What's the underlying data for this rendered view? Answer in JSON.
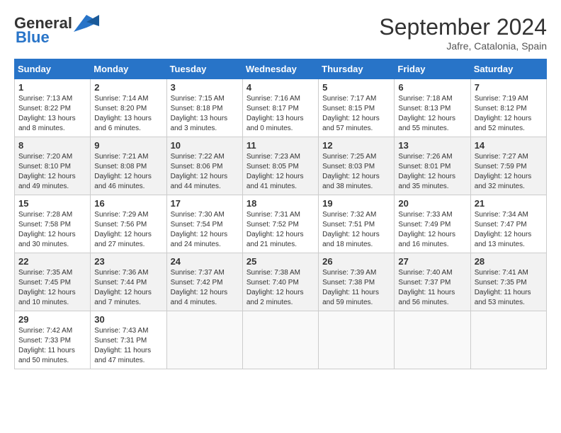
{
  "header": {
    "logo_line1": "General",
    "logo_line2": "Blue",
    "month_title": "September 2024",
    "subtitle": "Jafre, Catalonia, Spain"
  },
  "days_of_week": [
    "Sunday",
    "Monday",
    "Tuesday",
    "Wednesday",
    "Thursday",
    "Friday",
    "Saturday"
  ],
  "weeks": [
    [
      {
        "day": "1",
        "sunrise": "Sunrise: 7:13 AM",
        "sunset": "Sunset: 8:22 PM",
        "daylight": "Daylight: 13 hours and 8 minutes."
      },
      {
        "day": "2",
        "sunrise": "Sunrise: 7:14 AM",
        "sunset": "Sunset: 8:20 PM",
        "daylight": "Daylight: 13 hours and 6 minutes."
      },
      {
        "day": "3",
        "sunrise": "Sunrise: 7:15 AM",
        "sunset": "Sunset: 8:18 PM",
        "daylight": "Daylight: 13 hours and 3 minutes."
      },
      {
        "day": "4",
        "sunrise": "Sunrise: 7:16 AM",
        "sunset": "Sunset: 8:17 PM",
        "daylight": "Daylight: 13 hours and 0 minutes."
      },
      {
        "day": "5",
        "sunrise": "Sunrise: 7:17 AM",
        "sunset": "Sunset: 8:15 PM",
        "daylight": "Daylight: 12 hours and 57 minutes."
      },
      {
        "day": "6",
        "sunrise": "Sunrise: 7:18 AM",
        "sunset": "Sunset: 8:13 PM",
        "daylight": "Daylight: 12 hours and 55 minutes."
      },
      {
        "day": "7",
        "sunrise": "Sunrise: 7:19 AM",
        "sunset": "Sunset: 8:12 PM",
        "daylight": "Daylight: 12 hours and 52 minutes."
      }
    ],
    [
      {
        "day": "8",
        "sunrise": "Sunrise: 7:20 AM",
        "sunset": "Sunset: 8:10 PM",
        "daylight": "Daylight: 12 hours and 49 minutes."
      },
      {
        "day": "9",
        "sunrise": "Sunrise: 7:21 AM",
        "sunset": "Sunset: 8:08 PM",
        "daylight": "Daylight: 12 hours and 46 minutes."
      },
      {
        "day": "10",
        "sunrise": "Sunrise: 7:22 AM",
        "sunset": "Sunset: 8:06 PM",
        "daylight": "Daylight: 12 hours and 44 minutes."
      },
      {
        "day": "11",
        "sunrise": "Sunrise: 7:23 AM",
        "sunset": "Sunset: 8:05 PM",
        "daylight": "Daylight: 12 hours and 41 minutes."
      },
      {
        "day": "12",
        "sunrise": "Sunrise: 7:25 AM",
        "sunset": "Sunset: 8:03 PM",
        "daylight": "Daylight: 12 hours and 38 minutes."
      },
      {
        "day": "13",
        "sunrise": "Sunrise: 7:26 AM",
        "sunset": "Sunset: 8:01 PM",
        "daylight": "Daylight: 12 hours and 35 minutes."
      },
      {
        "day": "14",
        "sunrise": "Sunrise: 7:27 AM",
        "sunset": "Sunset: 7:59 PM",
        "daylight": "Daylight: 12 hours and 32 minutes."
      }
    ],
    [
      {
        "day": "15",
        "sunrise": "Sunrise: 7:28 AM",
        "sunset": "Sunset: 7:58 PM",
        "daylight": "Daylight: 12 hours and 30 minutes."
      },
      {
        "day": "16",
        "sunrise": "Sunrise: 7:29 AM",
        "sunset": "Sunset: 7:56 PM",
        "daylight": "Daylight: 12 hours and 27 minutes."
      },
      {
        "day": "17",
        "sunrise": "Sunrise: 7:30 AM",
        "sunset": "Sunset: 7:54 PM",
        "daylight": "Daylight: 12 hours and 24 minutes."
      },
      {
        "day": "18",
        "sunrise": "Sunrise: 7:31 AM",
        "sunset": "Sunset: 7:52 PM",
        "daylight": "Daylight: 12 hours and 21 minutes."
      },
      {
        "day": "19",
        "sunrise": "Sunrise: 7:32 AM",
        "sunset": "Sunset: 7:51 PM",
        "daylight": "Daylight: 12 hours and 18 minutes."
      },
      {
        "day": "20",
        "sunrise": "Sunrise: 7:33 AM",
        "sunset": "Sunset: 7:49 PM",
        "daylight": "Daylight: 12 hours and 16 minutes."
      },
      {
        "day": "21",
        "sunrise": "Sunrise: 7:34 AM",
        "sunset": "Sunset: 7:47 PM",
        "daylight": "Daylight: 12 hours and 13 minutes."
      }
    ],
    [
      {
        "day": "22",
        "sunrise": "Sunrise: 7:35 AM",
        "sunset": "Sunset: 7:45 PM",
        "daylight": "Daylight: 12 hours and 10 minutes."
      },
      {
        "day": "23",
        "sunrise": "Sunrise: 7:36 AM",
        "sunset": "Sunset: 7:44 PM",
        "daylight": "Daylight: 12 hours and 7 minutes."
      },
      {
        "day": "24",
        "sunrise": "Sunrise: 7:37 AM",
        "sunset": "Sunset: 7:42 PM",
        "daylight": "Daylight: 12 hours and 4 minutes."
      },
      {
        "day": "25",
        "sunrise": "Sunrise: 7:38 AM",
        "sunset": "Sunset: 7:40 PM",
        "daylight": "Daylight: 12 hours and 2 minutes."
      },
      {
        "day": "26",
        "sunrise": "Sunrise: 7:39 AM",
        "sunset": "Sunset: 7:38 PM",
        "daylight": "Daylight: 11 hours and 59 minutes."
      },
      {
        "day": "27",
        "sunrise": "Sunrise: 7:40 AM",
        "sunset": "Sunset: 7:37 PM",
        "daylight": "Daylight: 11 hours and 56 minutes."
      },
      {
        "day": "28",
        "sunrise": "Sunrise: 7:41 AM",
        "sunset": "Sunset: 7:35 PM",
        "daylight": "Daylight: 11 hours and 53 minutes."
      }
    ],
    [
      {
        "day": "29",
        "sunrise": "Sunrise: 7:42 AM",
        "sunset": "Sunset: 7:33 PM",
        "daylight": "Daylight: 11 hours and 50 minutes."
      },
      {
        "day": "30",
        "sunrise": "Sunrise: 7:43 AM",
        "sunset": "Sunset: 7:31 PM",
        "daylight": "Daylight: 11 hours and 47 minutes."
      },
      null,
      null,
      null,
      null,
      null
    ]
  ]
}
